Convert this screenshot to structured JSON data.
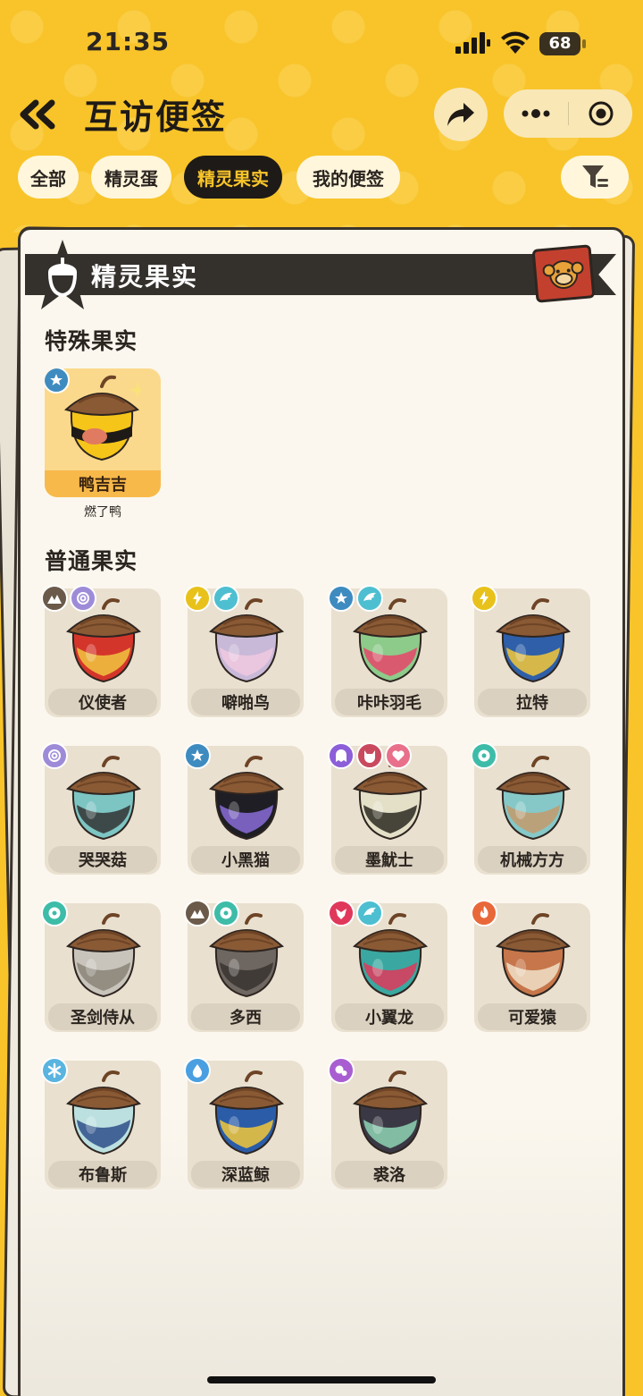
{
  "status": {
    "time": "21:35",
    "battery": "68"
  },
  "header": {
    "title": "互访便签"
  },
  "tabs": [
    {
      "label": "全部",
      "active": false
    },
    {
      "label": "精灵蛋",
      "active": false
    },
    {
      "label": "精灵果实",
      "active": true
    },
    {
      "label": "我的便签",
      "active": false
    }
  ],
  "banner": {
    "title": "精灵果实"
  },
  "special_section": {
    "title": "特殊果实",
    "items": [
      {
        "name": "鸭吉吉",
        "subtitle": "燃了鸭",
        "types": [
          "normal"
        ]
      }
    ]
  },
  "normal_section": {
    "title": "普通果实",
    "items": [
      {
        "name": "仪使者",
        "types": [
          "ground",
          "illusion"
        ],
        "colors": [
          "#D4352B",
          "#F0C440"
        ]
      },
      {
        "name": "噼啪鸟",
        "types": [
          "electric",
          "wing"
        ],
        "colors": [
          "#C9B9D8",
          "#F0C8E0"
        ]
      },
      {
        "name": "咔咔羽毛",
        "types": [
          "normal",
          "wing"
        ],
        "colors": [
          "#8DCB8A",
          "#E6476A"
        ]
      },
      {
        "name": "拉特",
        "types": [
          "electric"
        ],
        "colors": [
          "#2E5FA8",
          "#F2C73A"
        ]
      },
      {
        "name": "哭哭菇",
        "types": [
          "illusion"
        ],
        "colors": [
          "#7CC5C3",
          "#333333"
        ]
      },
      {
        "name": "小黑猫",
        "types": [
          "normal"
        ],
        "colors": [
          "#1E1E24",
          "#8A6CD8"
        ]
      },
      {
        "name": "墨魷士",
        "types": [
          "ghost",
          "demon",
          "cute"
        ],
        "colors": [
          "#E4E0C8",
          "#2C2820"
        ]
      },
      {
        "name": "机械方方",
        "types": [
          "mechanical"
        ],
        "colors": [
          "#86C8C8",
          "#C49A6C"
        ]
      },
      {
        "name": "圣剑侍从",
        "types": [
          "mechanical"
        ],
        "colors": [
          "#C8C4BC",
          "#8A8478"
        ]
      },
      {
        "name": "多西",
        "types": [
          "ground",
          "mechanical"
        ],
        "colors": [
          "#6E6660",
          "#3A3430"
        ]
      },
      {
        "name": "小翼龙",
        "types": [
          "dragon",
          "wing"
        ],
        "colors": [
          "#3AA8A0",
          "#E0385A"
        ]
      },
      {
        "name": "可爱猿",
        "types": [
          "fire"
        ],
        "colors": [
          "#C6764A",
          "#F0E0C8"
        ]
      },
      {
        "name": "布鲁斯",
        "types": [
          "ice"
        ],
        "colors": [
          "#BCE0E0",
          "#2E4E88"
        ]
      },
      {
        "name": "深蓝鲸",
        "types": [
          "water"
        ],
        "colors": [
          "#2A5CA8",
          "#F2C73A"
        ]
      },
      {
        "name": "裘洛",
        "types": [
          "poison"
        ],
        "colors": [
          "#3A3844",
          "#8ED4B4"
        ]
      }
    ]
  },
  "type_colors": {
    "normal": "#3E8BC0",
    "ground": "#6B5A4A",
    "illusion": "#9E8BD8",
    "electric": "#E8C21A",
    "wing": "#4DBFD0",
    "ghost": "#8C5ED8",
    "demon": "#C94A5E",
    "cute": "#E8708A",
    "mechanical": "#3DBCA8",
    "dragon": "#E0385A",
    "fire": "#E8683A",
    "ice": "#5AB4E0",
    "water": "#4A9FE0",
    "poison": "#A85ED0"
  }
}
